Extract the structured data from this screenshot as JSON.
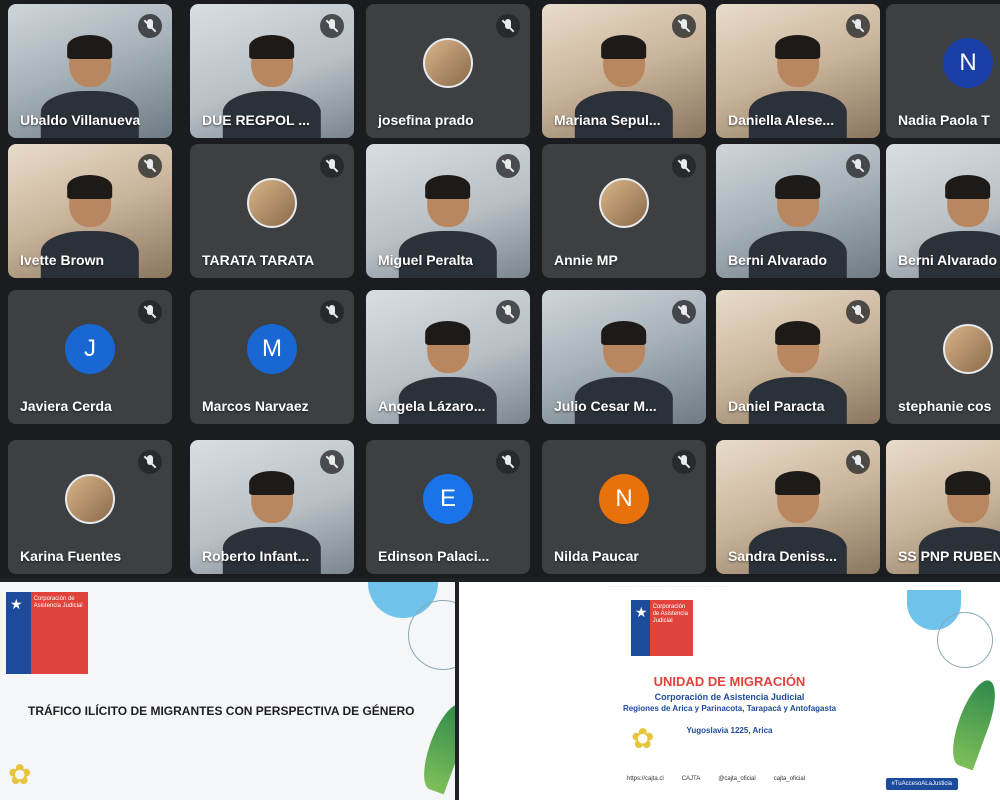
{
  "participants": [
    {
      "name": "Ubaldo Villanueva",
      "type": "camera",
      "style": "cam"
    },
    {
      "name": "DUE REGPOL ...",
      "type": "camera",
      "style": "room"
    },
    {
      "name": "josefina prado",
      "type": "avatar-photo",
      "style": "plain"
    },
    {
      "name": "Mariana Sepul...",
      "type": "camera",
      "style": "warm"
    },
    {
      "name": "Daniella Alese...",
      "type": "camera",
      "style": "warm"
    },
    {
      "name": "Nadia Paola T",
      "type": "initial",
      "initial": "N",
      "avatar_color": "#1a3fa6"
    },
    {
      "name": "Ivette Brown",
      "type": "camera",
      "style": "warm"
    },
    {
      "name": "TARATA TARATA",
      "type": "avatar-photo",
      "style": "plain"
    },
    {
      "name": "Miguel Peralta",
      "type": "camera",
      "style": "room"
    },
    {
      "name": "Annie MP",
      "type": "avatar-photo",
      "style": "plain"
    },
    {
      "name": "Berni Alvarado",
      "type": "camera",
      "style": "cam"
    },
    {
      "name": "Berni Alvarado",
      "type": "camera",
      "style": "room"
    },
    {
      "name": "Javiera Cerda",
      "type": "initial",
      "initial": "J",
      "avatar_color": "#1967d2"
    },
    {
      "name": "Marcos Narvaez",
      "type": "initial",
      "initial": "M",
      "avatar_color": "#1967d2"
    },
    {
      "name": "Angela Lázaro...",
      "type": "camera",
      "style": "room"
    },
    {
      "name": "Julio Cesar M...",
      "type": "camera",
      "style": "cam"
    },
    {
      "name": "Daniel Paracta",
      "type": "camera",
      "style": "warm"
    },
    {
      "name": "stephanie cos",
      "type": "avatar-photo",
      "style": "plain"
    },
    {
      "name": "Karina Fuentes",
      "type": "avatar-photo",
      "style": "plain"
    },
    {
      "name": "Roberto Infant...",
      "type": "camera",
      "style": "room"
    },
    {
      "name": "Edinson Palaci...",
      "type": "initial",
      "initial": "E",
      "avatar_color": "#1a73e8"
    },
    {
      "name": "Nilda Paucar",
      "type": "initial",
      "initial": "N",
      "avatar_color": "#e8710a"
    },
    {
      "name": "Sandra Deniss...",
      "type": "camera",
      "style": "warm"
    },
    {
      "name": "SS PNP RUBEN",
      "type": "camera",
      "style": "warm"
    }
  ],
  "slide_left": {
    "logo_text": "Corporación de Asistencia Judicial",
    "title": "TRÁFICO ILÍCITO DE MIGRANTES CON PERSPECTIVA DE GÉNERO"
  },
  "slide_right": {
    "logo_text": "Corporación de Asistencia Judicial",
    "title": "UNIDAD DE MIGRACIÓN",
    "subtitle": "Corporación de Asistencia Judicial",
    "regions": "Regiones de Arica y Parinacota, Tarapacá y Antofagasta",
    "address": "Yugoslavia 1225, Arica",
    "footer_links": [
      "https://cajta.cl",
      "CAJTA",
      "@cajta_oficial",
      "cajta_oficial"
    ],
    "hashtag": "#TuAccesoALaJusticia"
  },
  "colors": {
    "brand_blue": "#1d4b9c",
    "brand_red": "#e0433b",
    "tile_bg": "#3c4043"
  }
}
